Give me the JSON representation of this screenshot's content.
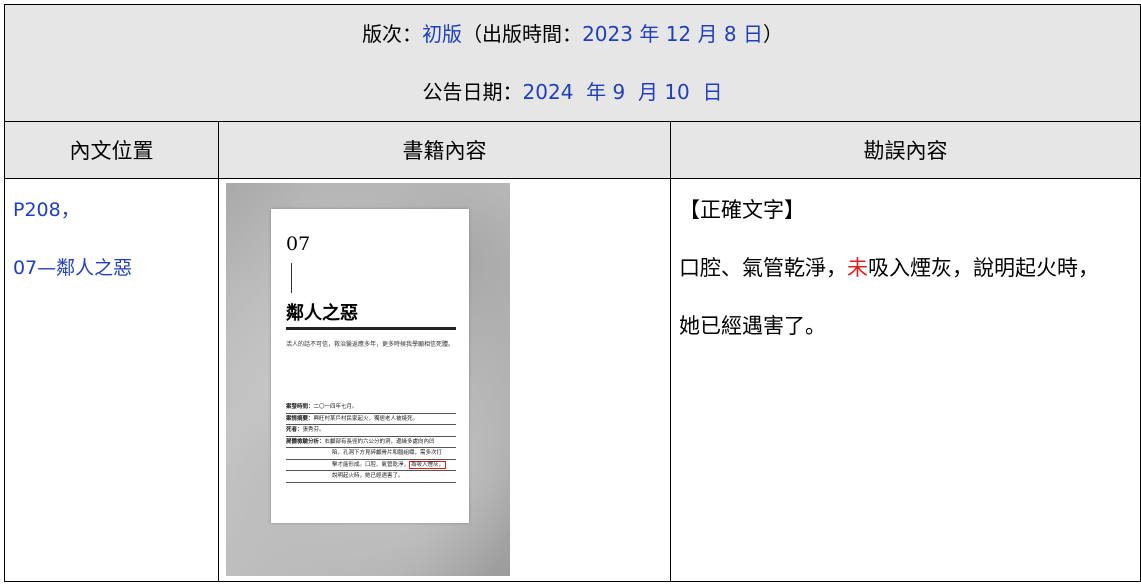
{
  "header": {
    "edition_label": "版次：",
    "edition_value": "初版",
    "pub_open": "（出版時間：",
    "pub_year": "2023",
    "pub_year_unit": " 年 ",
    "pub_month": "12",
    "pub_month_unit": " 月 ",
    "pub_day": "8",
    "pub_day_unit": " 日",
    "pub_close": "）",
    "announce_label": "公告日期：",
    "ann_year": "2024",
    "ann_year_unit": "  年 ",
    "ann_month": "9",
    "ann_month_unit": "  月 ",
    "ann_day": "10",
    "ann_day_unit": "  日"
  },
  "columns": [
    "內文位置",
    "書籍內容",
    "勘誤內容"
  ],
  "row": {
    "page_ref": "P208，",
    "section": "07—鄰人之惡",
    "book_page": {
      "chapter_number": "07",
      "chapter_title": "鄰人之惡",
      "epigraph": "活人的話不可信，救治醫返應多年，更多時候我學願相信死體。",
      "info": [
        {
          "label": "案發時間：",
          "text": "二〇一四年七月。"
        },
        {
          "label": "案情摘要：",
          "text": "興旺村某戶村民家起火，獨居老人被燒死。"
        },
        {
          "label": "死者：",
          "text": "張秀芬。"
        },
        {
          "label": "屍體檢驗分析：",
          "text": "右顱部有長徑約六公分的洞，邊緣多處向內凹"
        },
        {
          "label": "",
          "text": "陷，孔洞下方見碎顱骨片和腦組織，需多次打"
        },
        {
          "label": "",
          "text": "擊才能形成。口腔、氣管乾淨，",
          "highlight": "為吸入煙灰，"
        },
        {
          "label": "",
          "text": "說明起火時，她已經遇害了。"
        }
      ]
    },
    "correction": {
      "title": "【正確文字】",
      "line1_before": "口腔、氣管乾淨，",
      "line1_highlight": "未",
      "line1_after": "吸入煙灰，說明起火時，",
      "line2": "她已經遇害了。"
    }
  },
  "colors": {
    "link_blue": "#1f3fbf",
    "highlight_red": "#e0201c",
    "header_gray": "#e6e6e6"
  }
}
